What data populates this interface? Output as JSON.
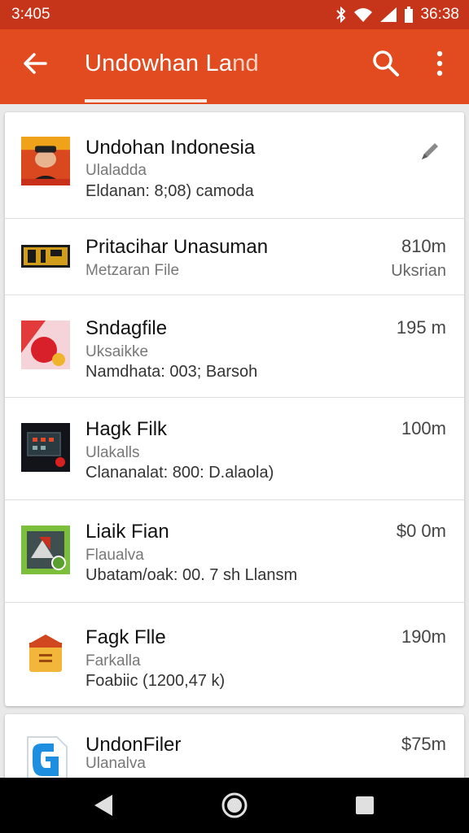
{
  "status_bar": {
    "time": "3:405",
    "clock": "36:38"
  },
  "app_bar": {
    "title_main": "Undowhan La",
    "title_faded": "nd"
  },
  "files": [
    {
      "title": "Undohan Indonesia",
      "subtitle": "Ulaladda",
      "detail": "Eldanan: 8;08) camoda",
      "size": "",
      "size_sub": ""
    },
    {
      "title": "Pritacihar Unasuman",
      "subtitle": "Metzaran File",
      "detail": "",
      "size": "810m",
      "size_sub": "Uksrian"
    },
    {
      "title": "Sndagfile",
      "subtitle": "Uksaikke",
      "detail": "Namdhata: 003; Barsoh",
      "size": "195 m",
      "size_sub": ""
    },
    {
      "title": "Hagk Filk",
      "subtitle": "Ulakalls",
      "detail": "Clananalat: 800: D.alaola)",
      "size": "100m",
      "size_sub": ""
    },
    {
      "title": "Liaik Fian",
      "subtitle": "Flaualva",
      "detail": "Ubatam/oak: 00.  7 sh Llansm",
      "size": "$0 0m",
      "size_sub": ""
    },
    {
      "title": "Fagk Flle",
      "subtitle": "Farkalla",
      "detail": "Foabiic (1200,47 k)",
      "size": "190m",
      "size_sub": ""
    },
    {
      "title": "UndonFiler",
      "subtitle": "Ulanalva",
      "detail": "",
      "size": "$75m",
      "size_sub": ""
    }
  ],
  "colors": {
    "status_bar": "#c6341a",
    "app_bar": "#e24a1f",
    "nav_bar": "#000000"
  }
}
